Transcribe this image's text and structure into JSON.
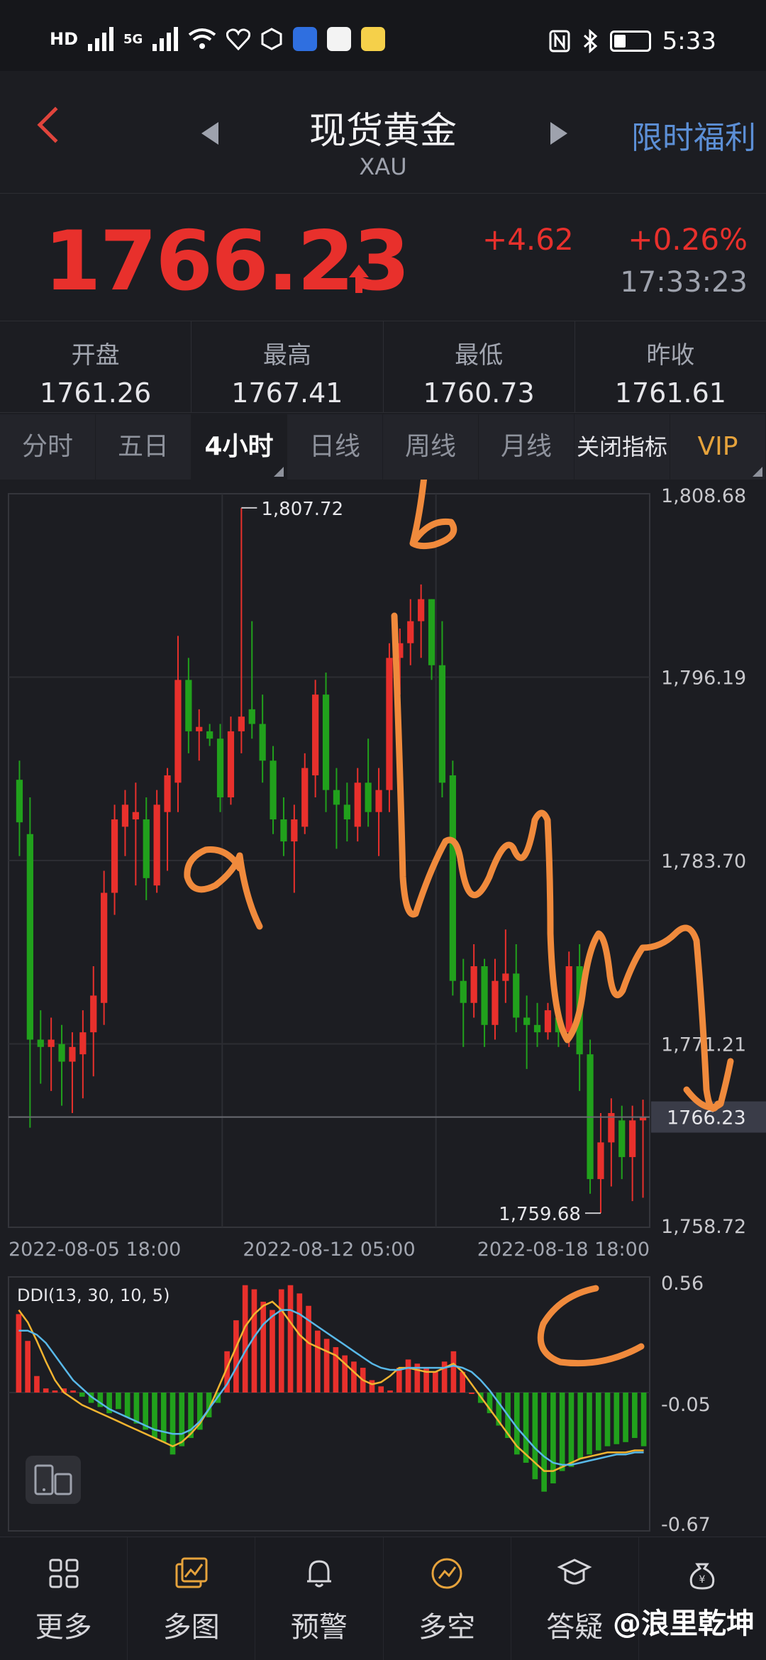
{
  "status": {
    "hd": "HD",
    "net": "5G",
    "apps": [
      "汽车之家",
      "sina",
      "微博"
    ],
    "time": "5:33"
  },
  "header": {
    "title": "现货黄金",
    "subtitle": "XAU",
    "promo": "限时福利"
  },
  "quote": {
    "price": "1766.23",
    "change": "+4.62",
    "percent": "+0.26%",
    "time": "17:33:23"
  },
  "stats": [
    {
      "label": "开盘",
      "value": "1761.26"
    },
    {
      "label": "最高",
      "value": "1767.41"
    },
    {
      "label": "最低",
      "value": "1760.73"
    },
    {
      "label": "昨收",
      "value": "1761.61"
    }
  ],
  "tabs": [
    "分时",
    "五日",
    "4小时",
    "日线",
    "周线",
    "月线",
    "关闭指标",
    "VIP"
  ],
  "colors": {
    "up": "#e8302c",
    "down": "#21a11c",
    "accent": "#5c8fd6",
    "vip": "#e6a33c",
    "annotation": "#f08a3c"
  },
  "chart_data": {
    "type": "candlestick",
    "y_axis_labels": [
      "1,808.68",
      "1,796.19",
      "1,783.70",
      "1,771.21",
      "1,758.72"
    ],
    "ylim": [
      1758.72,
      1808.68
    ],
    "x_axis_labels": [
      "2022-08-05 18:00",
      "2022-08-12 05:00",
      "2022-08-18 18:00"
    ],
    "annotations": {
      "high": "1,807.72",
      "low": "1,759.68",
      "current": "1766.23"
    },
    "handwriting": [
      "b",
      "a",
      "c"
    ],
    "candles": [
      {
        "o": 1789.2,
        "h": 1790.5,
        "l": 1784.0,
        "c": 1786.3
      },
      {
        "o": 1785.5,
        "h": 1788.0,
        "l": 1765.5,
        "c": 1771.5
      },
      {
        "o": 1771.5,
        "h": 1773.5,
        "l": 1768.5,
        "c": 1771.0
      },
      {
        "o": 1771.0,
        "h": 1773.0,
        "l": 1768.0,
        "c": 1771.5
      },
      {
        "o": 1771.2,
        "h": 1772.5,
        "l": 1767.0,
        "c": 1770.0
      },
      {
        "o": 1770.0,
        "h": 1772.0,
        "l": 1766.5,
        "c": 1771.0
      },
      {
        "o": 1770.5,
        "h": 1773.5,
        "l": 1767.5,
        "c": 1772.0
      },
      {
        "o": 1772.0,
        "h": 1776.5,
        "l": 1769.0,
        "c": 1774.5
      },
      {
        "o": 1774.0,
        "h": 1783.0,
        "l": 1772.5,
        "c": 1781.5
      },
      {
        "o": 1781.5,
        "h": 1787.5,
        "l": 1780.0,
        "c": 1786.5
      },
      {
        "o": 1786.0,
        "h": 1788.5,
        "l": 1784.0,
        "c": 1787.5
      },
      {
        "o": 1786.5,
        "h": 1789.0,
        "l": 1782.0,
        "c": 1787.0
      },
      {
        "o": 1786.5,
        "h": 1788.0,
        "l": 1781.0,
        "c": 1782.5
      },
      {
        "o": 1782.0,
        "h": 1788.5,
        "l": 1781.5,
        "c": 1787.5
      },
      {
        "o": 1787.0,
        "h": 1790.0,
        "l": 1783.0,
        "c": 1789.5
      },
      {
        "o": 1789.0,
        "h": 1799.0,
        "l": 1787.0,
        "c": 1796.0
      },
      {
        "o": 1796.0,
        "h": 1797.5,
        "l": 1791.0,
        "c": 1792.5
      },
      {
        "o": 1792.5,
        "h": 1794.0,
        "l": 1790.5,
        "c": 1792.8
      },
      {
        "o": 1792.5,
        "h": 1793.0,
        "l": 1791.5,
        "c": 1792.0
      },
      {
        "o": 1792.0,
        "h": 1793.0,
        "l": 1787.0,
        "c": 1788.0
      },
      {
        "o": 1788.0,
        "h": 1793.5,
        "l": 1787.5,
        "c": 1792.5
      },
      {
        "o": 1792.5,
        "h": 1807.72,
        "l": 1791.0,
        "c": 1793.5
      },
      {
        "o": 1794.0,
        "h": 1800.0,
        "l": 1792.0,
        "c": 1793.0
      },
      {
        "o": 1793.0,
        "h": 1795.0,
        "l": 1789.0,
        "c": 1790.5
      },
      {
        "o": 1790.5,
        "h": 1791.5,
        "l": 1785.5,
        "c": 1786.5
      },
      {
        "o": 1786.5,
        "h": 1788.0,
        "l": 1784.0,
        "c": 1785.0
      },
      {
        "o": 1785.0,
        "h": 1787.5,
        "l": 1781.5,
        "c": 1786.5
      },
      {
        "o": 1786.0,
        "h": 1791.0,
        "l": 1785.5,
        "c": 1790.0
      },
      {
        "o": 1789.5,
        "h": 1796.0,
        "l": 1788.0,
        "c": 1795.0
      },
      {
        "o": 1795.0,
        "h": 1796.5,
        "l": 1787.0,
        "c": 1788.5
      },
      {
        "o": 1788.5,
        "h": 1790.0,
        "l": 1784.5,
        "c": 1787.5
      },
      {
        "o": 1787.5,
        "h": 1789.0,
        "l": 1785.0,
        "c": 1786.5
      },
      {
        "o": 1786.0,
        "h": 1790.0,
        "l": 1785.0,
        "c": 1789.0
      },
      {
        "o": 1789.0,
        "h": 1792.0,
        "l": 1786.0,
        "c": 1787.0
      },
      {
        "o": 1787.0,
        "h": 1790.0,
        "l": 1784.0,
        "c": 1788.5
      },
      {
        "o": 1788.5,
        "h": 1798.5,
        "l": 1787.0,
        "c": 1797.5
      },
      {
        "o": 1797.5,
        "h": 1799.5,
        "l": 1795.0,
        "c": 1798.5
      },
      {
        "o": 1798.5,
        "h": 1801.5,
        "l": 1797.0,
        "c": 1800.0
      },
      {
        "o": 1800.0,
        "h": 1802.5,
        "l": 1797.5,
        "c": 1801.5
      },
      {
        "o": 1801.5,
        "h": 1801.0,
        "l": 1796.0,
        "c": 1797.0
      },
      {
        "o": 1797.0,
        "h": 1800.0,
        "l": 1788.0,
        "c": 1789.0
      },
      {
        "o": 1789.5,
        "h": 1790.5,
        "l": 1774.5,
        "c": 1775.5
      },
      {
        "o": 1775.5,
        "h": 1777.0,
        "l": 1771.0,
        "c": 1774.0
      },
      {
        "o": 1774.0,
        "h": 1778.0,
        "l": 1773.0,
        "c": 1776.5
      },
      {
        "o": 1776.5,
        "h": 1777.0,
        "l": 1771.0,
        "c": 1772.5
      },
      {
        "o": 1772.5,
        "h": 1777.0,
        "l": 1771.5,
        "c": 1775.5
      },
      {
        "o": 1775.5,
        "h": 1779.0,
        "l": 1774.0,
        "c": 1776.0
      },
      {
        "o": 1776.0,
        "h": 1778.0,
        "l": 1772.0,
        "c": 1773.0
      },
      {
        "o": 1773.0,
        "h": 1774.5,
        "l": 1769.5,
        "c": 1772.5
      },
      {
        "o": 1772.5,
        "h": 1774.0,
        "l": 1771.0,
        "c": 1772.0
      },
      {
        "o": 1772.0,
        "h": 1774.0,
        "l": 1771.5,
        "c": 1773.5
      },
      {
        "o": 1773.0,
        "h": 1774.0,
        "l": 1771.0,
        "c": 1772.0
      },
      {
        "o": 1772.0,
        "h": 1777.5,
        "l": 1771.0,
        "c": 1776.5
      },
      {
        "o": 1776.5,
        "h": 1778.0,
        "l": 1768.0,
        "c": 1770.5
      },
      {
        "o": 1770.5,
        "h": 1771.5,
        "l": 1761.0,
        "c": 1762.0
      },
      {
        "o": 1762.0,
        "h": 1766.5,
        "l": 1759.68,
        "c": 1764.5
      },
      {
        "o": 1764.5,
        "h": 1767.5,
        "l": 1761.5,
        "c": 1766.5
      },
      {
        "o": 1766.0,
        "h": 1767.0,
        "l": 1762.0,
        "c": 1763.5
      },
      {
        "o": 1763.5,
        "h": 1767.0,
        "l": 1760.5,
        "c": 1766.0
      },
      {
        "o": 1766.0,
        "h": 1767.41,
        "l": 1760.73,
        "c": 1766.23
      }
    ],
    "indicator": {
      "name": "DDI(13, 30, 10, 5)",
      "axis_labels": [
        "0.56",
        "-0.05",
        "-0.67"
      ],
      "ylim": [
        -0.67,
        0.56
      ],
      "bars": [
        0.38,
        0.25,
        0.08,
        0.02,
        0.01,
        0.02,
        0.01,
        -0.02,
        -0.05,
        -0.07,
        -0.1,
        -0.08,
        -0.12,
        -0.15,
        -0.18,
        -0.22,
        -0.24,
        -0.3,
        -0.26,
        -0.22,
        -0.18,
        -0.12,
        -0.05,
        0.2,
        0.35,
        0.52,
        0.5,
        0.44,
        0.4,
        0.5,
        0.52,
        0.48,
        0.42,
        0.3,
        0.26,
        0.22,
        0.18,
        0.15,
        0.12,
        0.06,
        0.03,
        0.01,
        0.12,
        0.16,
        0.14,
        0.12,
        0.1,
        0.15,
        0.2,
        0.1,
        0.0,
        -0.05,
        -0.1,
        -0.16,
        -0.22,
        -0.3,
        -0.34,
        -0.42,
        -0.48,
        -0.44,
        -0.38,
        -0.36,
        -0.32,
        -0.3,
        -0.28,
        -0.26,
        -0.25,
        -0.24,
        -0.22,
        -0.26
      ],
      "line1": [
        0.4,
        0.34,
        0.25,
        0.15,
        0.06,
        0.0,
        -0.03,
        -0.06,
        -0.08,
        -0.1,
        -0.12,
        -0.14,
        -0.16,
        -0.18,
        -0.2,
        -0.22,
        -0.24,
        -0.26,
        -0.24,
        -0.2,
        -0.15,
        -0.08,
        0.02,
        0.12,
        0.22,
        0.32,
        0.38,
        0.42,
        0.44,
        0.4,
        0.34,
        0.28,
        0.24,
        0.22,
        0.2,
        0.18,
        0.14,
        0.1,
        0.06,
        0.04,
        0.05,
        0.08,
        0.12,
        0.12,
        0.11,
        0.1,
        0.1,
        0.12,
        0.14,
        0.1,
        0.04,
        -0.02,
        -0.08,
        -0.14,
        -0.2,
        -0.26,
        -0.3,
        -0.34,
        -0.38,
        -0.38,
        -0.36,
        -0.34,
        -0.32,
        -0.31,
        -0.3,
        -0.29,
        -0.29,
        -0.29,
        -0.28,
        -0.28
      ],
      "line2": [
        0.3,
        0.3,
        0.28,
        0.24,
        0.18,
        0.12,
        0.06,
        0.02,
        -0.02,
        -0.05,
        -0.08,
        -0.1,
        -0.12,
        -0.14,
        -0.16,
        -0.18,
        -0.19,
        -0.2,
        -0.2,
        -0.18,
        -0.14,
        -0.08,
        -0.02,
        0.04,
        0.12,
        0.2,
        0.27,
        0.33,
        0.37,
        0.4,
        0.4,
        0.38,
        0.35,
        0.32,
        0.29,
        0.26,
        0.23,
        0.2,
        0.17,
        0.14,
        0.12,
        0.11,
        0.11,
        0.12,
        0.12,
        0.12,
        0.12,
        0.12,
        0.13,
        0.12,
        0.1,
        0.06,
        0.01,
        -0.05,
        -0.11,
        -0.17,
        -0.22,
        -0.27,
        -0.31,
        -0.34,
        -0.35,
        -0.35,
        -0.34,
        -0.33,
        -0.32,
        -0.31,
        -0.3,
        -0.3,
        -0.29,
        -0.29
      ]
    }
  },
  "nav": [
    {
      "label": "更多",
      "icon": "grid-icon"
    },
    {
      "label": "多图",
      "icon": "multi-chart-icon"
    },
    {
      "label": "预警",
      "icon": "bell-icon"
    },
    {
      "label": "多空",
      "icon": "bull-bear-icon"
    },
    {
      "label": "答疑",
      "icon": "mortarboard-icon"
    },
    {
      "label": "",
      "icon": "money-bag-icon"
    }
  ],
  "watermark": "@浪里乾坤"
}
